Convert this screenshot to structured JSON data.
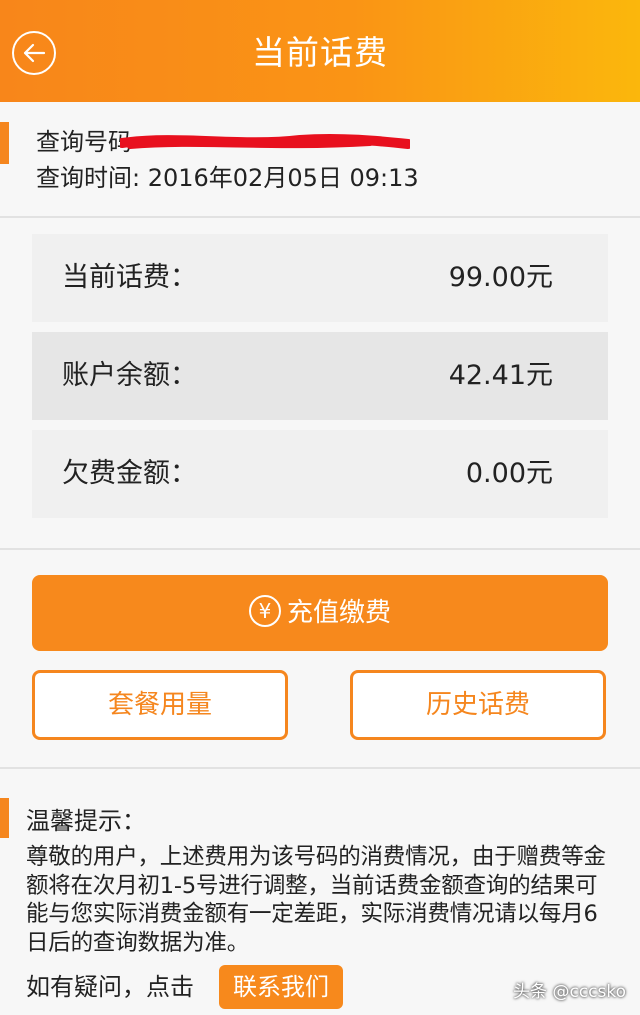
{
  "header": {
    "title": "当前话费"
  },
  "info": {
    "phone_label": "查询号码",
    "query_time": "查询时间: 2016年02月05日 09:13"
  },
  "amounts": [
    {
      "label": "当前话费：",
      "value": "99.00元"
    },
    {
      "label": "账户余额：",
      "value": "42.41元"
    },
    {
      "label": "欠费金额：",
      "value": "0.00元"
    }
  ],
  "actions": {
    "recharge": "充值缴费",
    "package_usage": "套餐用量",
    "history_bill": "历史话费"
  },
  "tips": {
    "title": "温馨提示：",
    "body": "尊敬的用户，上述费用为该号码的消费情况，由于赠费等金额将在次月初1-5号进行调整，当前话费金额查询的结果可能与您实际消费金额有一定差距，实际消费情况请以每月6日后的查询数据为准。",
    "ask": "如有疑问，点击",
    "contact": "联系我们"
  },
  "watermark": "头条 @cccsko",
  "colors": {
    "accent": "#f7891c",
    "header_end": "#fbb70c",
    "redaction": "#e8101e"
  }
}
